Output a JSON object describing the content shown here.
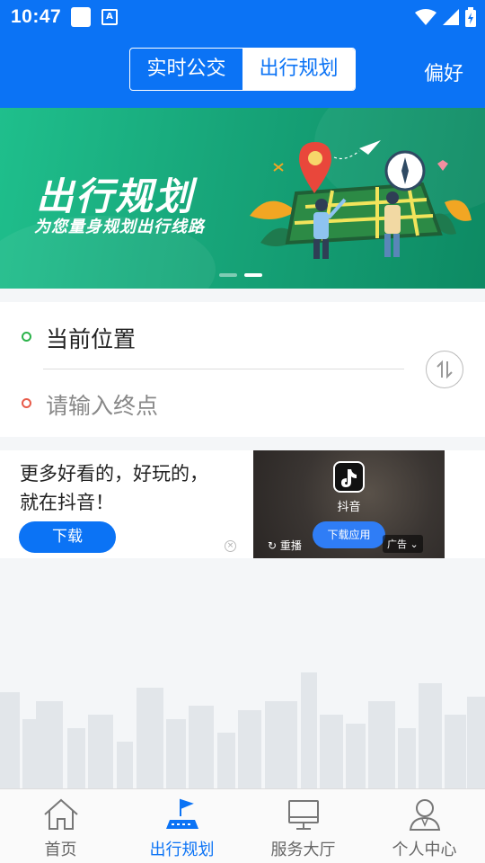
{
  "status_bar": {
    "time": "10:47",
    "icons": [
      "notification-square-icon",
      "font-a-icon",
      "wifi-icon",
      "signal-icon",
      "battery-charging-icon"
    ]
  },
  "header": {
    "segments": [
      "实时公交",
      "出行规划"
    ],
    "active_segment": "出行规划",
    "preference": "偏好",
    "accent_color": "#0b73f5"
  },
  "banner": {
    "title": "出行规划",
    "subtitle": "为您量身规划出行线路",
    "page_count": 2,
    "active_page": 2
  },
  "route": {
    "start": "当前位置",
    "end_placeholder": "请输入终点",
    "start_color": "#2bb34a",
    "end_color": "#e85b4a"
  },
  "ad": {
    "line1": "更多好看的，好玩的，",
    "line2": "就在抖音！",
    "download": "下载",
    "app_name": "抖音",
    "app_download": "下载应用",
    "replay": "重播",
    "ad_label": "广告"
  },
  "tabs": [
    {
      "label": "首页",
      "icon": "home-icon"
    },
    {
      "label": "出行规划",
      "icon": "route-flag-icon",
      "active": true
    },
    {
      "label": "服务大厅",
      "icon": "monitor-icon"
    },
    {
      "label": "个人中心",
      "icon": "user-icon"
    }
  ]
}
